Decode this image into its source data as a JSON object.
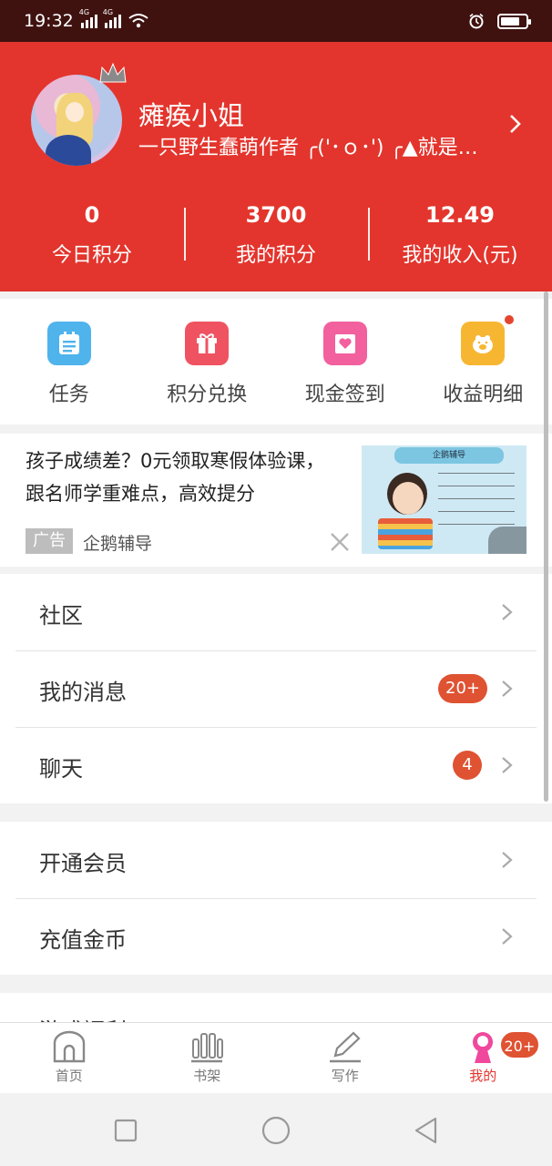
{
  "status_bar": {
    "time": "19:32",
    "network_1": "4G",
    "network_2": "4G",
    "battery_level": 0.75
  },
  "profile": {
    "name": "瘫痪小姐",
    "bio": "一只野生蠢萌作者 ╭('･ｏ･') ╭▲就是…",
    "avatar_icon": "anime-avatar",
    "accent_color": "#e3352d"
  },
  "stats": [
    {
      "value": "0",
      "label": "今日积分"
    },
    {
      "value": "3700",
      "label": "我的积分"
    },
    {
      "value": "12.49",
      "label": "我的收入(元)"
    }
  ],
  "actions": [
    {
      "label": "任务",
      "icon": "task-list-icon",
      "color": "#4fb3ec"
    },
    {
      "label": "积分兑换",
      "icon": "gift-icon",
      "color": "#ef5361"
    },
    {
      "label": "现金签到",
      "icon": "heart-envelope-icon",
      "color": "#f2609e"
    },
    {
      "label": "收益明细",
      "icon": "piggy-bank-icon",
      "color": "#f7b631"
    }
  ],
  "ad": {
    "text": "孩子成绩差？0元领取寒假体验课，跟名师学重难点，高效提分",
    "badge": "广告",
    "source": "企鹅辅导",
    "image": {
      "banner": "企鹅辅导"
    }
  },
  "menu_group_1": [
    {
      "label": "社区"
    },
    {
      "label": "我的消息",
      "badge": "20+"
    },
    {
      "label": "聊天",
      "badge": "4"
    }
  ],
  "menu_group_2": [
    {
      "label": "开通会员"
    },
    {
      "label": "充值金币"
    }
  ],
  "menu_peek": {
    "label": "游戏福利"
  },
  "tabbar": [
    {
      "label": "首页",
      "icon": "home-icon"
    },
    {
      "label": "书架",
      "icon": "bookshelf-icon"
    },
    {
      "label": "写作",
      "icon": "pencil-icon"
    },
    {
      "label": "我的",
      "icon": "profile-icon",
      "badge": "20+"
    }
  ],
  "navbar": {
    "buttons": [
      "recent-apps",
      "home",
      "back"
    ]
  }
}
